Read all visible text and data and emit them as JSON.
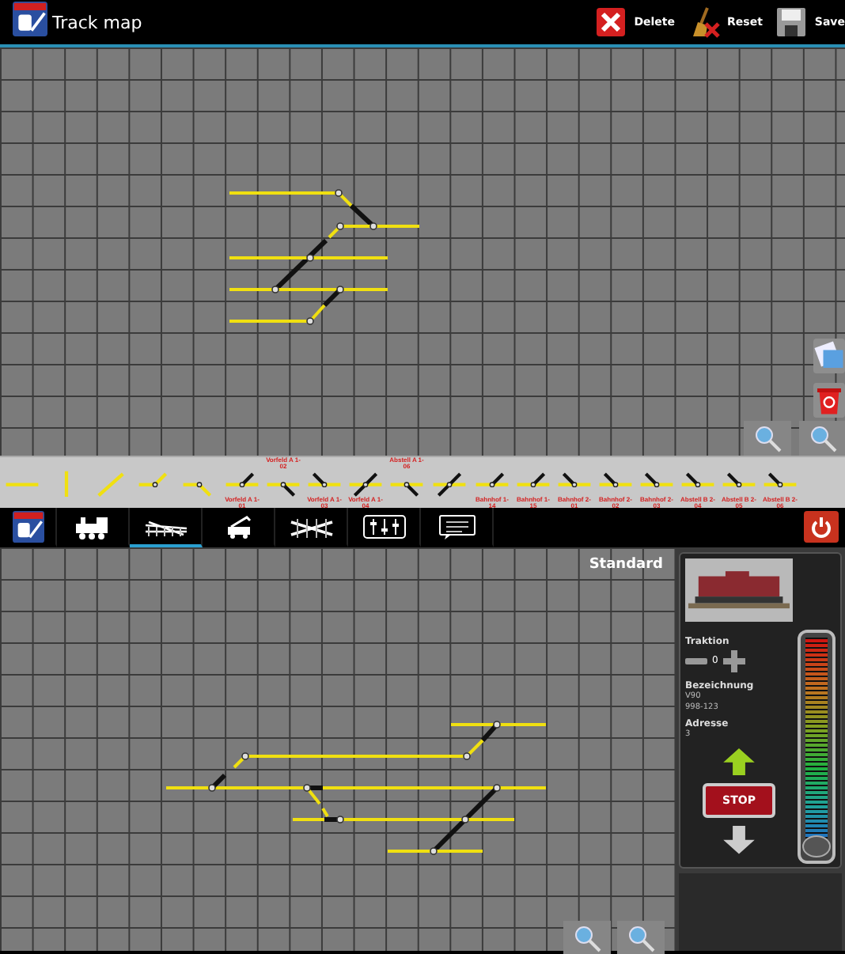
{
  "toolbar": {
    "title": "Track map",
    "actions": [
      {
        "kind": "delete",
        "label": "Delete"
      },
      {
        "kind": "reset",
        "label": "Reset"
      },
      {
        "kind": "save",
        "label": "Save"
      }
    ]
  },
  "palette": [
    {
      "kind": "straight"
    },
    {
      "kind": "vertical"
    },
    {
      "kind": "diagonal"
    },
    {
      "kind": "switch-up"
    },
    {
      "kind": "switch-down"
    },
    {
      "kind": "turnout-up-right",
      "label": "Vorfeld A 1-01"
    },
    {
      "kind": "turnout-down-right",
      "label": "Vorfeld A 1-02"
    },
    {
      "kind": "turnout-up-left",
      "label": "Vorfeld A 1-03"
    },
    {
      "kind": "crossover",
      "label": "Vorfeld A 1-04"
    },
    {
      "kind": "turnout-down-right",
      "label": "Abstell A 1-06"
    },
    {
      "kind": "crossover"
    },
    {
      "kind": "turnout-up-right",
      "label": "Bahnhof 1-14"
    },
    {
      "kind": "turnout-up-right",
      "label": "Bahnhof 1-15"
    },
    {
      "kind": "turnout-up-left",
      "label": "Bahnhof 2-01"
    },
    {
      "kind": "turnout-up-left",
      "label": "Bahnhof 2-02"
    },
    {
      "kind": "turnout-up-left",
      "label": "Bahnhof 2-03"
    },
    {
      "kind": "turnout-up-left",
      "label": "Abstell B 2-04"
    },
    {
      "kind": "turnout-up-left",
      "label": "Abstell B 2-05"
    },
    {
      "kind": "turnout-up-left",
      "label": "Abstell B 2-06"
    }
  ],
  "tabs": [
    {
      "kind": "logo",
      "selected": false
    },
    {
      "kind": "locomotive",
      "selected": false
    },
    {
      "kind": "tracks",
      "selected": true
    },
    {
      "kind": "crane",
      "selected": false
    },
    {
      "kind": "crossing",
      "selected": false
    },
    {
      "kind": "mixer",
      "selected": false
    },
    {
      "kind": "messages",
      "selected": false
    }
  ],
  "layout_view": {
    "label": "Standard"
  },
  "locomotive": {
    "traction_label": "Traktion",
    "traction_count": "0",
    "name_label": "Bezeichnung",
    "name": "V90",
    "number": "998-123",
    "address_label": "Adresse",
    "address": "3",
    "stop": "STOP",
    "speed": {
      "level": 0
    }
  }
}
